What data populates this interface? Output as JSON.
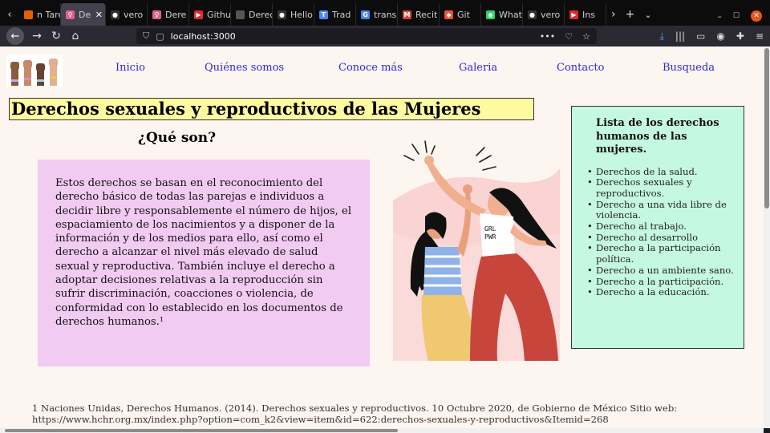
{
  "browser": {
    "tabs": [
      {
        "label": "n Tare",
        "color": "#e66000",
        "glyph": ""
      },
      {
        "label": "De",
        "color": "#e05f8a",
        "glyph": "♀",
        "active": true
      },
      {
        "label": "vero",
        "color": "#333",
        "glyph": "●"
      },
      {
        "label": "Dere",
        "color": "#e05f8a",
        "glyph": "♀"
      },
      {
        "label": "Githu",
        "color": "#e02828",
        "glyph": "▶"
      },
      {
        "label": "Derecho",
        "color": "#555",
        "glyph": ""
      },
      {
        "label": "Hello",
        "color": "#333",
        "glyph": "●"
      },
      {
        "label": "Trad",
        "color": "#4a8af4",
        "glyph": "T"
      },
      {
        "label": "trans",
        "color": "#4285f4",
        "glyph": "G"
      },
      {
        "label": "Recit",
        "color": "#d14836",
        "glyph": "M"
      },
      {
        "label": "Git",
        "color": "#f05033",
        "glyph": "◆"
      },
      {
        "label": "What",
        "color": "#25d366",
        "glyph": "◉"
      },
      {
        "label": "vero",
        "color": "#333",
        "glyph": "●"
      },
      {
        "label": "Ins",
        "color": "#e02828",
        "glyph": "▶"
      }
    ],
    "url": "localhost:3000"
  },
  "site": {
    "nav": [
      "Inicio",
      "Quiénes somos",
      "Conoce más",
      "Galeria",
      "Contacto",
      "Busqueda"
    ],
    "title": "Derechos sexuales y reproductivos de las Mujeres",
    "subtitle": "¿Qué son?",
    "body": "Estos derechos se basan en el reconocimiento del derecho básico de todas las parejas e individuos a decidir libre y responsablemente el número de hijos, el espaciamiento de los nacimientos y a disponer de la información y de los medios para ello, así como el derecho a alcanzar el nivel más elevado de salud sexual y reproductiva. También incluye el derecho a adoptar decisiones relativas a la reproducción sin sufrir discriminación, coacciones o violencia, de conformidad con lo establecido en los documentos de derechos humanos.¹",
    "illustration_text": "GRL PWR",
    "list_title": "Lista de los derechos humanos de las mujeres.",
    "list_items": [
      "Derechos de la salud.",
      "Derechos sexuales y reproductivos.",
      "Derecho a una vida libre de violencia.",
      "Derecho al trabajo.",
      "Derecho al desarrollo",
      "Derecho a la participación política.",
      "Derecho a un ambiente sano.",
      "Derecho a la participación.",
      "Derecho a la educación."
    ],
    "footnote": "1 Naciones Unidas, Derechos Humanos. (2014). Derechos sexuales y reproductivos. 10 Octubre 2020, de Gobierno de México Sitio web: https://www.hchr.org.mx/index.php?option=com_k2&view=item&id=622:derechos-sexuales-y-reproductivos&Itemid=268"
  }
}
